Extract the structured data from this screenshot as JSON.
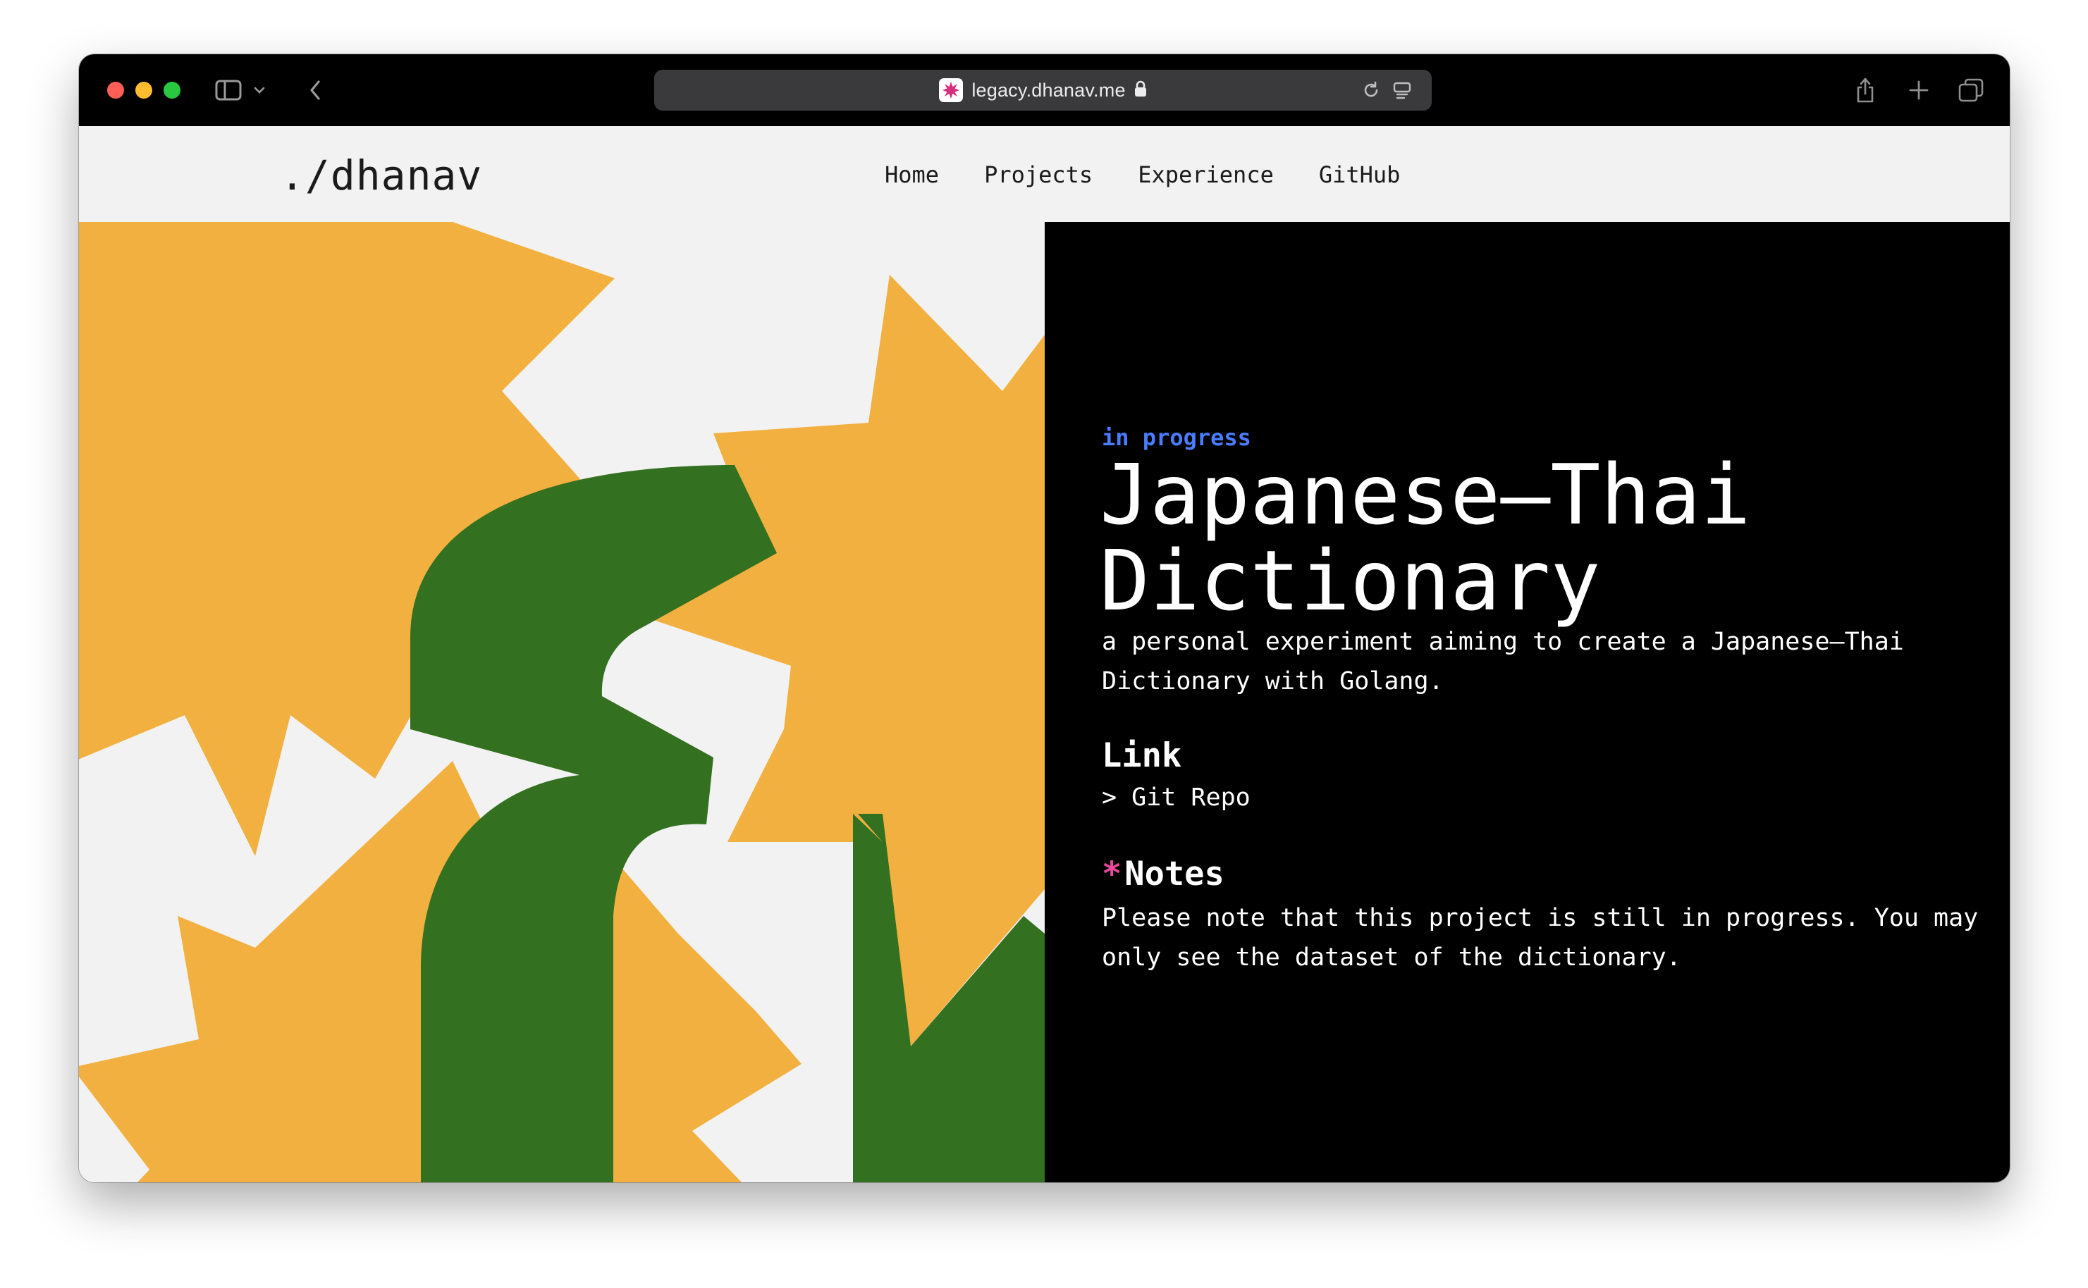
{
  "browser": {
    "url": "legacy.dhanav.me",
    "icons": {
      "sidebar": "sidebar-icon",
      "chevron": "chevron-down-icon",
      "back": "back-arrow-icon",
      "lock": "lock-icon",
      "reload": "reload-icon",
      "reader": "reader-icon",
      "share": "share-icon",
      "new_tab": "plus-icon",
      "tabs": "tab-overview-icon"
    }
  },
  "site": {
    "logo": "./dhanav",
    "nav": [
      "Home",
      "Projects",
      "Experience",
      "GitHub"
    ]
  },
  "project": {
    "status": "in progress",
    "title": "Japanese—Thai Dictionary",
    "description": "a personal experiment aiming to create a Japanese—Thai Dictionary with Golang.",
    "link_heading": "Link",
    "link_label": "> Git Repo",
    "notes_marker": "*",
    "notes_heading": "Notes",
    "notes_text": "Please note that this project is still in progress. You may only see the dataset of the dictionary."
  },
  "colors": {
    "status": "#4a7cff",
    "star": "#f2b040",
    "glyph": "#337020",
    "panel": "#000000",
    "asterisk": "#e64a9a"
  }
}
